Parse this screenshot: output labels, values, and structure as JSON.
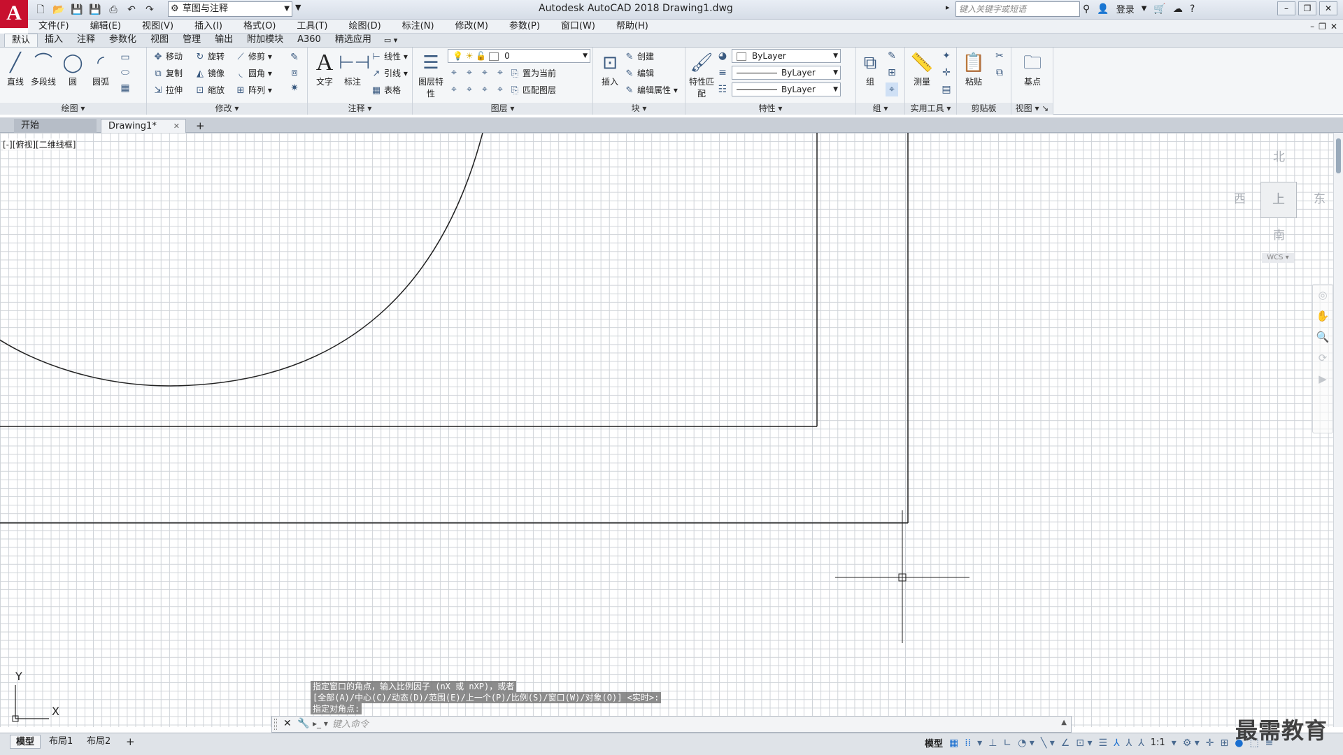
{
  "titlebar": {
    "workspace": "草图与注释",
    "window_title": "Autodesk AutoCAD 2018    Drawing1.dwg",
    "search_placeholder": "键入关键字或短语",
    "login": "登录"
  },
  "menus": [
    "文件(F)",
    "编辑(E)",
    "视图(V)",
    "插入(I)",
    "格式(O)",
    "工具(T)",
    "绘图(D)",
    "标注(N)",
    "修改(M)",
    "参数(P)",
    "窗口(W)",
    "帮助(H)"
  ],
  "ribbon_tabs": [
    "默认",
    "插入",
    "注释",
    "参数化",
    "视图",
    "管理",
    "输出",
    "附加模块",
    "A360",
    "精选应用"
  ],
  "ribbon": {
    "draw": {
      "title": "绘图",
      "line": "直线",
      "polyline": "多段线",
      "circle": "圆",
      "arc": "圆弧"
    },
    "modify": {
      "title": "修改",
      "move": "移动",
      "rotate": "旋转",
      "trim": "修剪",
      "copy": "复制",
      "mirror": "镜像",
      "fillet": "圆角",
      "stretch": "拉伸",
      "scale": "缩放",
      "array": "阵列"
    },
    "annotation": {
      "title": "注释",
      "text": "文字",
      "dimension": "标注",
      "linear": "线性",
      "leader": "引线",
      "table": "表格"
    },
    "layers": {
      "title": "图层",
      "properties": "图层特性",
      "current_layer": "0",
      "set_current": "置为当前",
      "match": "匹配图层"
    },
    "block": {
      "title": "块",
      "insert": "插入",
      "create": "创建",
      "edit": "编辑",
      "edit_attr": "编辑属性"
    },
    "properties": {
      "title": "特性",
      "match": "特性匹配",
      "color": "ByLayer",
      "linetype": "ByLayer",
      "lineweight": "ByLayer"
    },
    "groups": {
      "title": "组",
      "group": "组"
    },
    "utilities": {
      "title": "实用工具",
      "measure": "测量"
    },
    "clipboard": {
      "title": "剪贴板",
      "paste": "粘贴"
    },
    "view": {
      "title": "视图",
      "base": "基点"
    }
  },
  "doc_tabs": {
    "start": "开始",
    "drawing": "Drawing1*"
  },
  "canvas": {
    "viewport_label": "[-][俯视][二维线框]"
  },
  "viewcube": {
    "north": "北",
    "south": "南",
    "east": "东",
    "west": "西",
    "face": "上",
    "wcs": "WCS"
  },
  "ucs": {
    "x": "X",
    "y": "Y"
  },
  "command": {
    "history": [
      "指定窗口的角点，输入比例因子 (nX 或 nXP)，或者",
      "[全部(A)/中心(C)/动态(D)/范围(E)/上一个(P)/比例(S)/窗口(W)/对象(O)] <实时>:",
      "指定对角点:"
    ],
    "placeholder": "键入命令"
  },
  "status": {
    "layout_tabs": [
      "模型",
      "布局1",
      "布局2"
    ],
    "model": "模型",
    "scale": "1:1"
  },
  "watermark": "最需教育"
}
